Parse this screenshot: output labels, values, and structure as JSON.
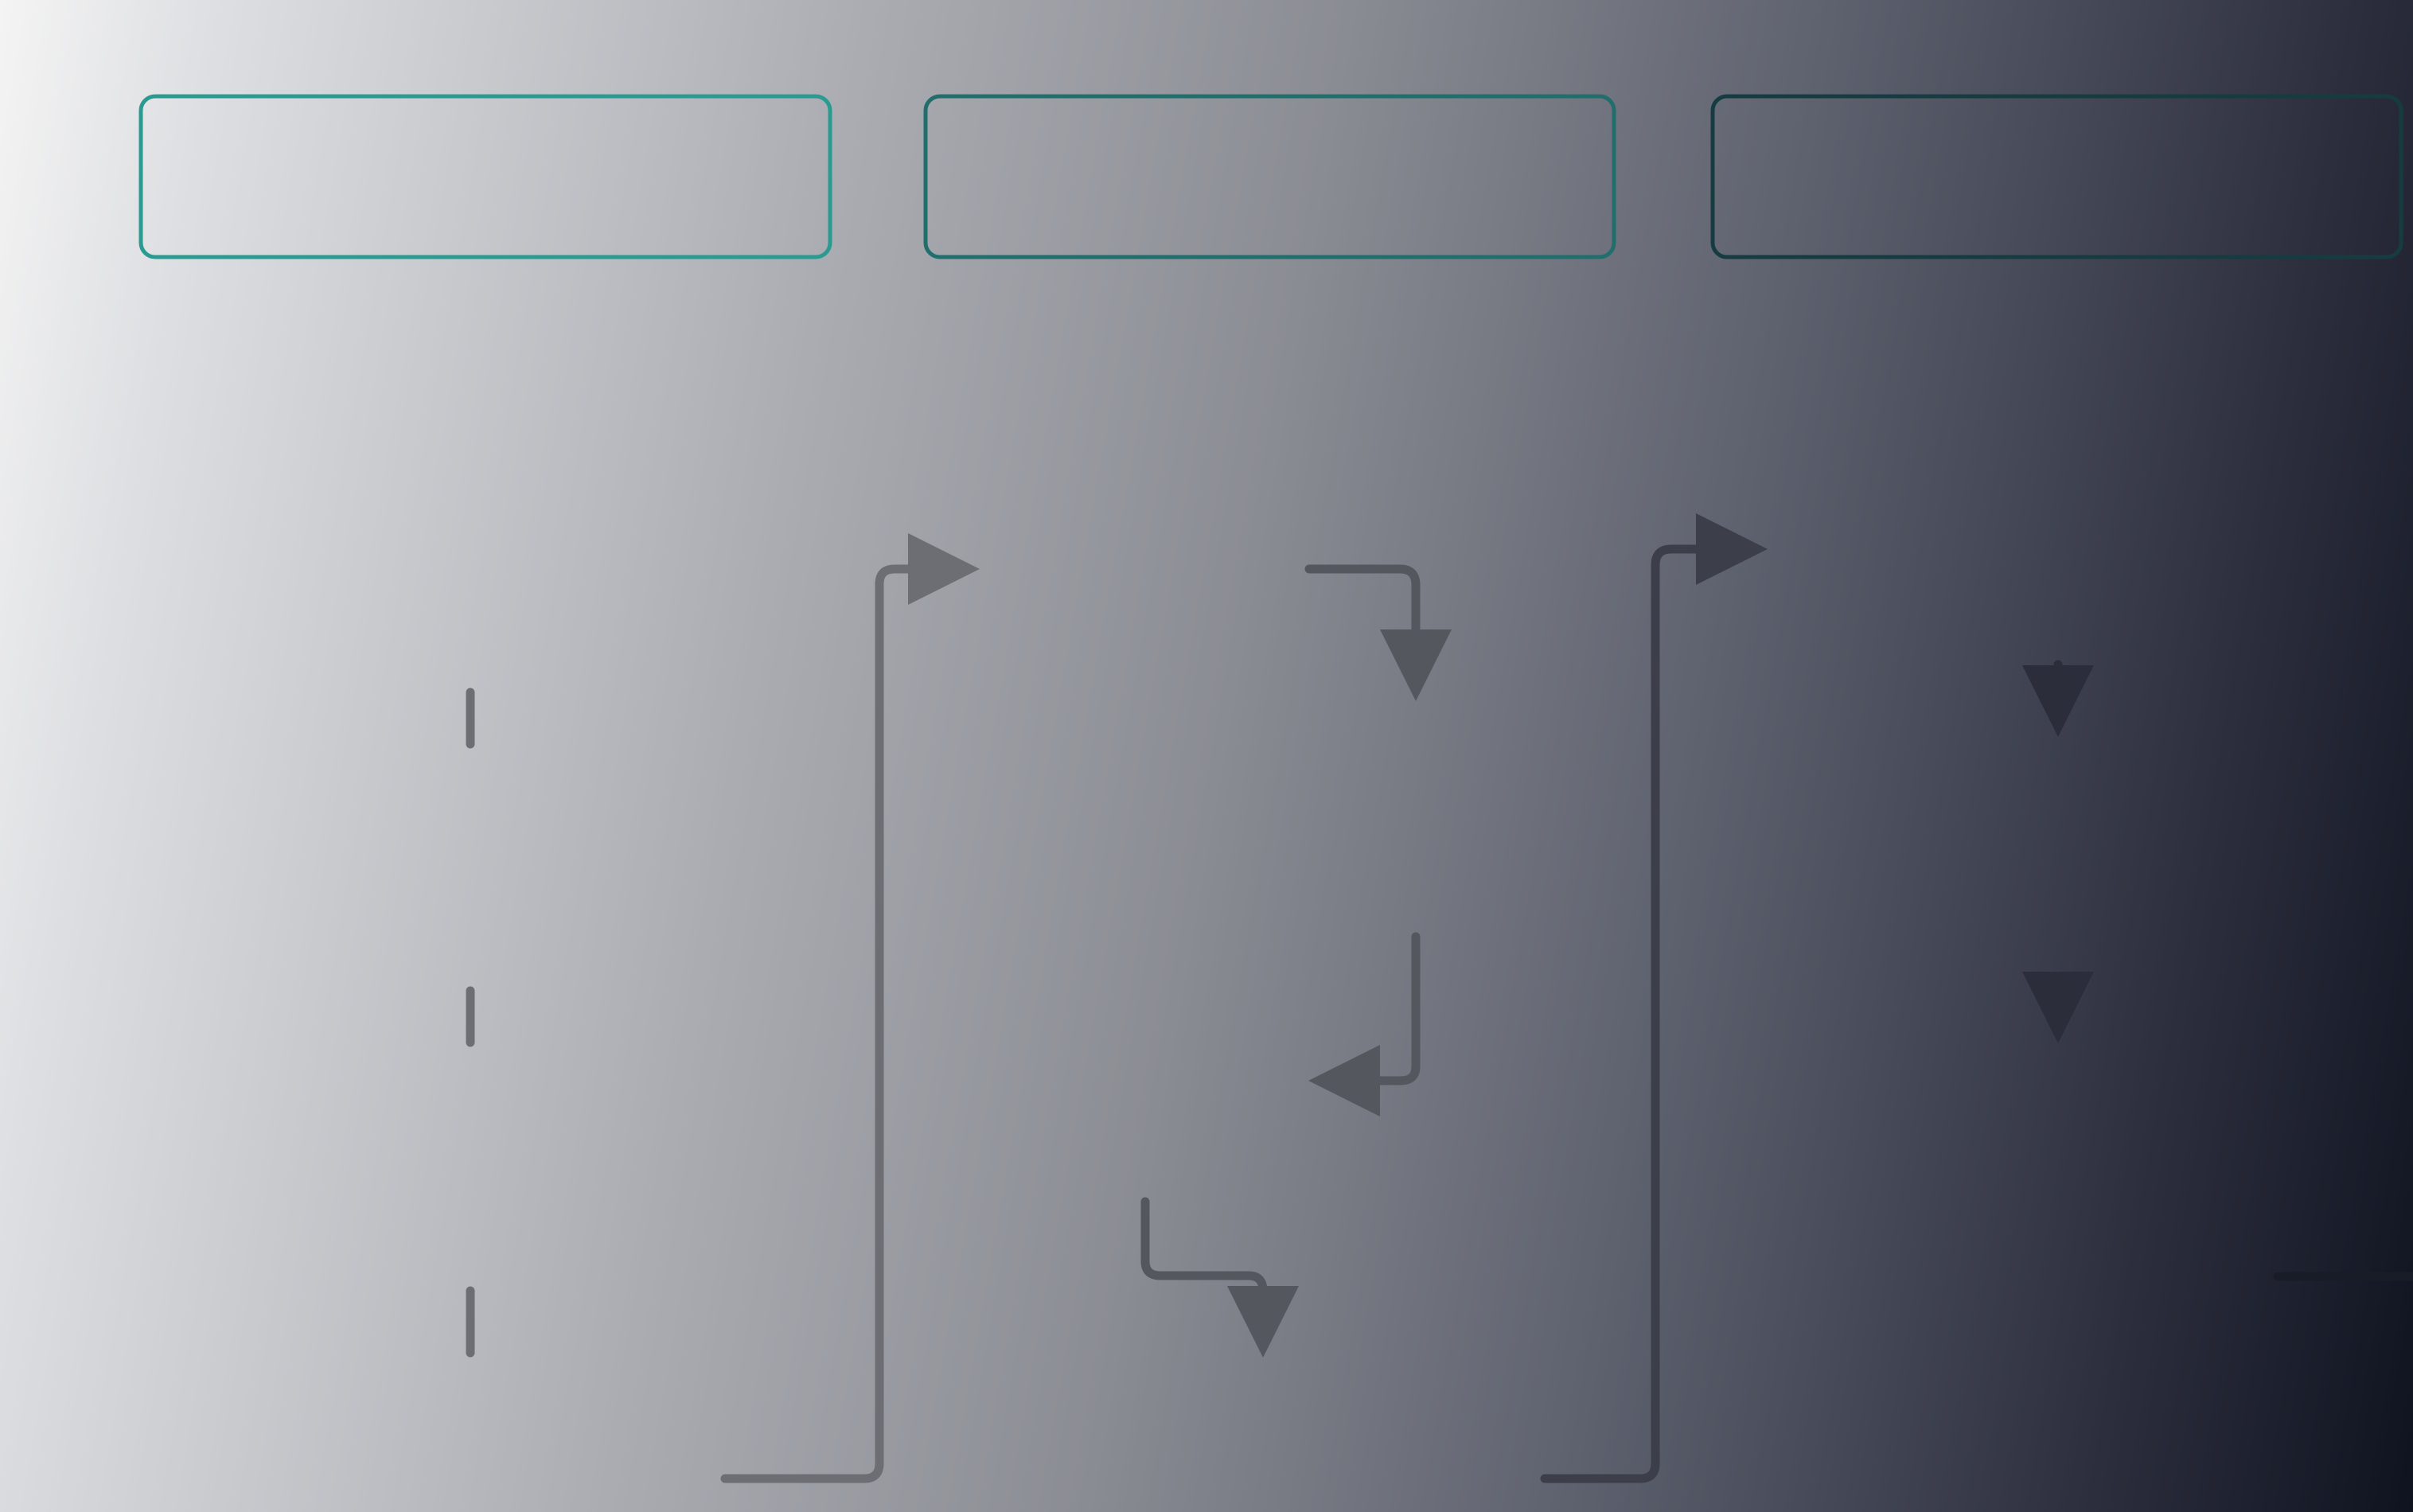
{
  "diagram": {
    "columns": [
      {
        "id": "column-1",
        "label": ""
      },
      {
        "id": "column-2",
        "label": ""
      },
      {
        "id": "column-3",
        "label": ""
      }
    ],
    "colors": {
      "box_stroke_left": "#2b9a91",
      "box_stroke_middle": "#216e6d",
      "box_stroke_right": "#163c42",
      "connector_light": "#6c6e74",
      "connector_mid": "#55575e",
      "connector_dark": "#3c3f49",
      "connector_darkest": "#2b2e3a",
      "connector_faint": "#181c27"
    }
  }
}
